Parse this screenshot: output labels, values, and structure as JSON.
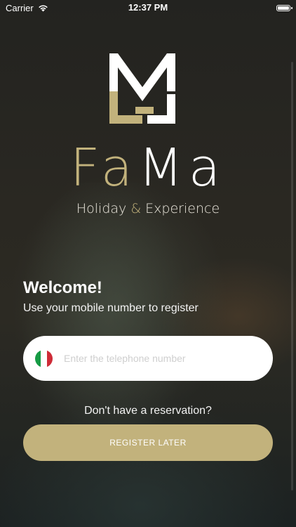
{
  "status_bar": {
    "carrier": "Carrier",
    "time": "12:37 PM"
  },
  "brand": {
    "fa": "Fa",
    "ma": "Ma",
    "tagline_pre": "Holiday ",
    "tagline_amp": "&",
    "tagline_post": " Experience"
  },
  "welcome": {
    "title": "Welcome!",
    "subtitle": "Use your mobile number to register"
  },
  "phone": {
    "placeholder": "Enter the telephone number",
    "flag": "Italy"
  },
  "reservation_prompt": "Don't have a reservation?",
  "register_later_label": "REGISTER LATER",
  "colors": {
    "gold": "#c2b27c",
    "background": "#2a2822"
  }
}
